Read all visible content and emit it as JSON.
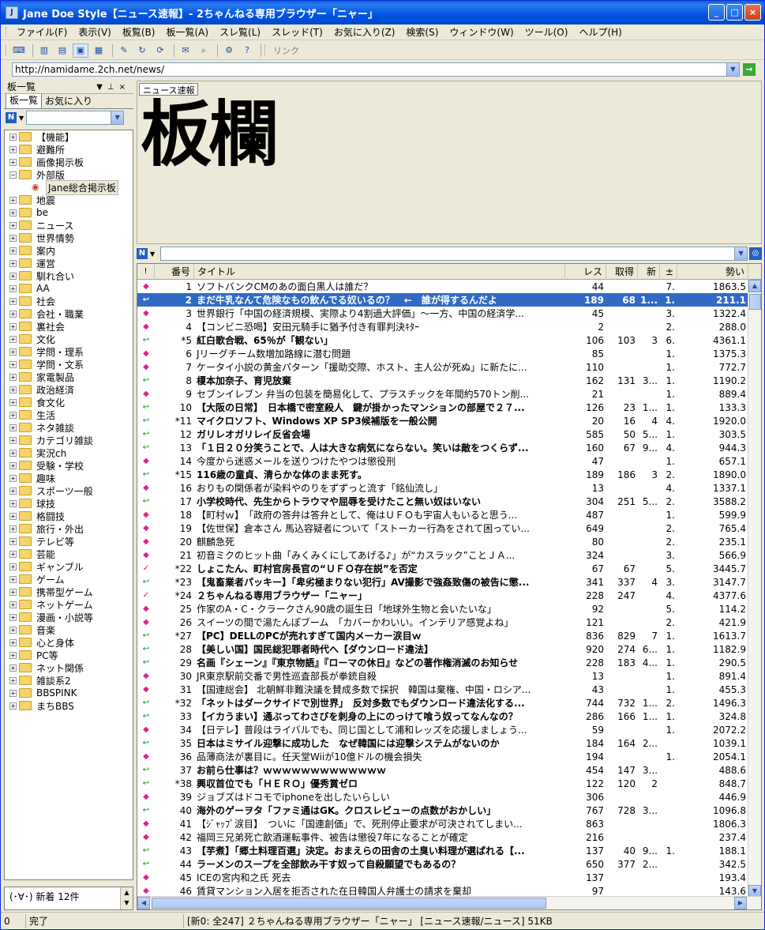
{
  "window": {
    "title": "Jane Doe Style【ニュース速報】- 2ちゃんねる専用ブラウザー「ニャー」"
  },
  "menu": [
    "ファイル(F)",
    "表示(V)",
    "板覧(B)",
    "板一覧(A)",
    "スレ覧(L)",
    "スレッド(T)",
    "お気に入り(Z)",
    "検索(S)",
    "ウィンドウ(W)",
    "ツール(O)",
    "ヘルプ(H)"
  ],
  "toolbar": {
    "link_label": "リンク"
  },
  "address": {
    "url": "http://namidame.2ch.net/news/"
  },
  "left_pane": {
    "title": "板一覧",
    "tabs": [
      "板一覧",
      "お気に入り"
    ],
    "tree": [
      "【機能】",
      "避難所",
      "画像掲示板",
      "外部版",
      "Jane総合掲示板",
      "地震",
      "be",
      "ニュース",
      "世界情勢",
      "案内",
      "運営",
      "馴れ合い",
      "AA",
      "社会",
      "会社・職業",
      "裏社会",
      "文化",
      "学問・理系",
      "学問・文系",
      "家電製品",
      "政治経済",
      "食文化",
      "生活",
      "ネタ雑談",
      "カテゴリ雑談",
      "実況ch",
      "受験・学校",
      "趣味",
      "スポーツ一般",
      "球技",
      "格闘技",
      "旅行・外出",
      "テレビ等",
      "芸能",
      "ギャンブル",
      "ゲーム",
      "携帯型ゲーム",
      "ネットゲーム",
      "漫画・小説等",
      "音楽",
      "心と身体",
      "PC等",
      "ネット関係",
      "雑談系2",
      "BBSPINK",
      "まちBBS"
    ],
    "status": "(･∀･) 新着 12件"
  },
  "preview": {
    "tab": "ニュース速報",
    "big_text": "板欄"
  },
  "thread_list": {
    "columns": [
      "!",
      "番号",
      "タイトル",
      "レス",
      "取得",
      "新",
      "±",
      "勢い"
    ],
    "rows": [
      {
        "mark": "◆",
        "num": "1",
        "title": "ソフトバンクCMのあの面白黒人は誰だ？",
        "res": "44",
        "get": "",
        "new": "",
        "pm": "7.",
        "pow": "1863.5"
      },
      {
        "mark": "↩",
        "num": "2",
        "title": "まだ牛乳なんて危険なもの飲んでる奴いるの？　←　誰が得するんだよ",
        "res": "189",
        "get": "68",
        "new": "1...",
        "pm": "1.",
        "pow": "211.1",
        "sel": true
      },
      {
        "mark": "◆",
        "num": "3",
        "title": "世界銀行「中国の経済規模、実際より4割過大評価」〜一方、中国の経済学...",
        "res": "45",
        "get": "",
        "new": "",
        "pm": "3.",
        "pow": "1322.4"
      },
      {
        "mark": "◆",
        "num": "4",
        "title": "【コンビニ恐喝】安田元騎手に猶予付き有罪判決ｷﾀｰ",
        "res": "2",
        "get": "",
        "new": "",
        "pm": "2.",
        "pow": "288.0"
      },
      {
        "mark": "↩",
        "num": "*5",
        "title": "紅白歌合戦、65％が「観ない」",
        "res": "106",
        "get": "103",
        "new": "3",
        "pm": "6.",
        "pow": "4361.1"
      },
      {
        "mark": "◆",
        "num": "6",
        "title": "Jリーグチーム数増加路線に潜む問題",
        "res": "85",
        "get": "",
        "new": "",
        "pm": "1.",
        "pow": "1375.3"
      },
      {
        "mark": "◆",
        "num": "7",
        "title": "ケータイ小説の黄金パターン「援助交際、ホスト、主人公が死ぬ」に新たに...",
        "res": "110",
        "get": "",
        "new": "",
        "pm": "1.",
        "pow": "772.7"
      },
      {
        "mark": "↩",
        "num": "8",
        "title": "榎本加奈子、育児放棄",
        "res": "162",
        "get": "131",
        "new": "3...",
        "pm": "1.",
        "pow": "1190.2"
      },
      {
        "mark": "◆",
        "num": "9",
        "title": "セブンイレブン 弁当の包装を簡易化して、プラスチックを年間約570トン削...",
        "res": "21",
        "get": "",
        "new": "",
        "pm": "1.",
        "pow": "889.4"
      },
      {
        "mark": "↩",
        "num": "10",
        "title": "【大阪の日常】　日本橋で密室殺人　鍵が掛かったマンションの部屋で２７...",
        "res": "126",
        "get": "23",
        "new": "1...",
        "pm": "1.",
        "pow": "133.3"
      },
      {
        "mark": "↩",
        "num": "*11",
        "title": "マイクロソフト、Windows XP SP3候補版を一般公開",
        "res": "20",
        "get": "16",
        "new": "4",
        "pm": "4.",
        "pow": "1920.0"
      },
      {
        "mark": "↩",
        "num": "12",
        "title": "ガリレオガリレイ反省会場",
        "res": "585",
        "get": "50",
        "new": "5...",
        "pm": "1.",
        "pow": "303.5"
      },
      {
        "mark": "↩",
        "num": "13",
        "title": "「１日２０分笑うことで、人は大きな病気にならない。笑いは敵をつくらず...",
        "res": "160",
        "get": "67",
        "new": "9...",
        "pm": "4.",
        "pow": "944.3"
      },
      {
        "mark": "◆",
        "num": "14",
        "title": "今度から迷惑メールを送りつけたやつは懲役刑",
        "res": "47",
        "get": "",
        "new": "",
        "pm": "1.",
        "pow": "657.1"
      },
      {
        "mark": "↩",
        "num": "*15",
        "title": "116歳の童貞、清らかな体のまま死す。",
        "res": "189",
        "get": "186",
        "new": "3",
        "pm": "2.",
        "pow": "1890.0"
      },
      {
        "mark": "◆",
        "num": "16",
        "title": "おりもの関係者が染料やのりをずずっと流す「銘仙流し」",
        "res": "13",
        "get": "",
        "new": "",
        "pm": "4.",
        "pow": "1337.1"
      },
      {
        "mark": "↩",
        "num": "17",
        "title": "小学校時代、先生からトラウマや屈辱を受けたこと無い奴はいない",
        "res": "304",
        "get": "251",
        "new": "5...",
        "pm": "2.",
        "pow": "3588.2"
      },
      {
        "mark": "◆",
        "num": "18",
        "title": "【町村ｗ】　「政府の答弁は答弁として、俺はＵＦＯも宇宙人もいると思う...",
        "res": "487",
        "get": "",
        "new": "",
        "pm": "1.",
        "pow": "599.9"
      },
      {
        "mark": "◆",
        "num": "19",
        "title": "【佐世保】倉本さん 馬込容疑者について「ストーカー行為をされて困ってい...",
        "res": "649",
        "get": "",
        "new": "",
        "pm": "2.",
        "pow": "765.4"
      },
      {
        "mark": "◆",
        "num": "20",
        "title": "麒麟急死",
        "res": "80",
        "get": "",
        "new": "",
        "pm": "2.",
        "pow": "235.1"
      },
      {
        "mark": "◆",
        "num": "21",
        "title": "初音ミクのヒット曲「みくみくにしてあげる♪」が“カスラック”ことＪＡ...",
        "res": "324",
        "get": "",
        "new": "",
        "pm": "3.",
        "pow": "566.9"
      },
      {
        "mark": "✓",
        "num": "*22",
        "title": "しょこたん、町村官房長官の“ＵＦＯ存在説”を否定",
        "res": "67",
        "get": "67",
        "new": "",
        "pm": "5.",
        "pow": "3445.7"
      },
      {
        "mark": "↩",
        "num": "*23",
        "title": "【鬼畜業者パッキー】「卑劣極まりない犯行」AV撮影で強姦致傷の被告に懲...",
        "res": "341",
        "get": "337",
        "new": "4",
        "pm": "3.",
        "pow": "3147.7"
      },
      {
        "mark": "✓",
        "num": "*24",
        "title": "２ちゃんねる専用ブラウザー「ニャー」",
        "res": "228",
        "get": "247",
        "new": "",
        "pm": "4.",
        "pow": "4377.6"
      },
      {
        "mark": "◆",
        "num": "25",
        "title": "作家のA・C・クラークさん90歳の誕生日「地球外生物と会いたいな」",
        "res": "92",
        "get": "",
        "new": "",
        "pm": "5.",
        "pow": "114.2"
      },
      {
        "mark": "◆",
        "num": "26",
        "title": "スイーツの間で湯たんぽブーム　「カバーかわいい。インテリア感覚よね」",
        "res": "121",
        "get": "",
        "new": "",
        "pm": "2.",
        "pow": "421.9"
      },
      {
        "mark": "↩",
        "num": "*27",
        "title": "【PC】DELLのPCが売れすぎて国内メーカー涙目ｗ",
        "res": "836",
        "get": "829",
        "new": "7",
        "pm": "1.",
        "pow": "1613.7"
      },
      {
        "mark": "↩",
        "num": "28",
        "title": "【美しい国】国民総犯罪者時代へ【ダウンロード違法】",
        "res": "920",
        "get": "274",
        "new": "6...",
        "pm": "1.",
        "pow": "1182.9"
      },
      {
        "mark": "↩",
        "num": "29",
        "title": "名画『シェーン』『東京物語』『ローマの休日』などの著作権消滅のお知らせ",
        "res": "228",
        "get": "183",
        "new": "4...",
        "pm": "1.",
        "pow": "290.5"
      },
      {
        "mark": "◆",
        "num": "30",
        "title": "JR東京駅前交番で男性巡査部長が拳銃自殺",
        "res": "13",
        "get": "",
        "new": "",
        "pm": "1.",
        "pow": "891.4"
      },
      {
        "mark": "◆",
        "num": "31",
        "title": "【国連総会】 北朝鮮非難決議を賛成多数で採択　韓国は棄権、中国・ロシア...",
        "res": "43",
        "get": "",
        "new": "",
        "pm": "1.",
        "pow": "455.3"
      },
      {
        "mark": "↩",
        "num": "*32",
        "title": "「ネットはダークサイドで別世界」　反対多数でもダウンロード違法化する...",
        "res": "744",
        "get": "732",
        "new": "1...",
        "pm": "2.",
        "pow": "1496.3"
      },
      {
        "mark": "↩",
        "num": "33",
        "title": "【イカうまい】通ぶってわさびを刺身の上にのっけて喰う奴ってなんなの？",
        "res": "286",
        "get": "166",
        "new": "1...",
        "pm": "1.",
        "pow": "324.8"
      },
      {
        "mark": "◆",
        "num": "34",
        "title": "【日テレ】普段はライバルでも、同じ国として浦和レッズを応援しましょう...",
        "res": "59",
        "get": "",
        "new": "",
        "pm": "1.",
        "pow": "2072.2"
      },
      {
        "mark": "↩",
        "num": "35",
        "title": "日本はミサイル迎撃に成功した　なぜ韓国には迎撃システムがないのか",
        "res": "184",
        "get": "164",
        "new": "2...",
        "pm": "",
        "pow": "1039.1"
      },
      {
        "mark": "◆",
        "num": "36",
        "title": "品薄商法が裏目に。任天堂Wiiが10億ドルの機会損失",
        "res": "194",
        "get": "",
        "new": "",
        "pm": "1.",
        "pow": "2054.1"
      },
      {
        "mark": "↩",
        "num": "37",
        "title": "お前ら仕事は？ｗｗｗｗｗｗｗｗｗｗｗｗｗ",
        "res": "454",
        "get": "147",
        "new": "3...",
        "pm": "",
        "pow": "488.6"
      },
      {
        "mark": "↩",
        "num": "*38",
        "title": "興収首位でも「ＨＥＲＯ」優秀賞ゼロ",
        "res": "122",
        "get": "120",
        "new": "2",
        "pm": "",
        "pow": "848.7"
      },
      {
        "mark": "◆",
        "num": "39",
        "title": "ジョブズはドコモでiphoneを出したいらしい",
        "res": "306",
        "get": "",
        "new": "",
        "pm": "",
        "pow": "446.9"
      },
      {
        "mark": "↩",
        "num": "40",
        "title": "海外のゲーヲタ「ファミ通はGK。クロスレビューの点数がおかしい」",
        "res": "767",
        "get": "728",
        "new": "3...",
        "pm": "",
        "pow": "1096.8"
      },
      {
        "mark": "◆",
        "num": "41",
        "title": "【ｼﾞｬｯﾌﾟ涙目】　ついに「国連創価」で、死刑停止要求が可決されてしまい...",
        "res": "863",
        "get": "",
        "new": "",
        "pm": "",
        "pow": "1806.3"
      },
      {
        "mark": "◆",
        "num": "42",
        "title": "福岡三兄弟死亡飲酒運転事件、被告は懲役7年になることが確定",
        "res": "216",
        "get": "",
        "new": "",
        "pm": "",
        "pow": "237.4"
      },
      {
        "mark": "↩",
        "num": "43",
        "title": "【芋煮】「郷土料理百選」決定。おまえらの田舎の土臭い料理が選ばれる【...",
        "res": "137",
        "get": "40",
        "new": "9...",
        "pm": "1.",
        "pow": "188.1"
      },
      {
        "mark": "↩",
        "num": "44",
        "title": "ラーメンのスープを全部飲み干す奴って自殺願望でもあるの？",
        "res": "650",
        "get": "377",
        "new": "2...",
        "pm": "",
        "pow": "342.5"
      },
      {
        "mark": "◆",
        "num": "45",
        "title": "ICEの宮内和之氏 死去",
        "res": "137",
        "get": "",
        "new": "",
        "pm": "",
        "pow": "193.4"
      },
      {
        "mark": "◆",
        "num": "46",
        "title": "賃貸マンション入居を拒否された在日韓国人弁護士の請求を棄却",
        "res": "97",
        "get": "",
        "new": "",
        "pm": "",
        "pow": "143.6"
      }
    ]
  },
  "status": {
    "count": "0",
    "state": "完了",
    "info": "[新0: 全247] ２ちゃんねる専用ブラウザー「ニャー」 [ニュース速報/ニュース] 51KB"
  },
  "colors": {
    "title_bar": "#0053e1",
    "selection": "#316ac5",
    "mark_new": "#e0208c",
    "mark_updated": "#1a8a1a",
    "mark_check": "#d02020"
  }
}
